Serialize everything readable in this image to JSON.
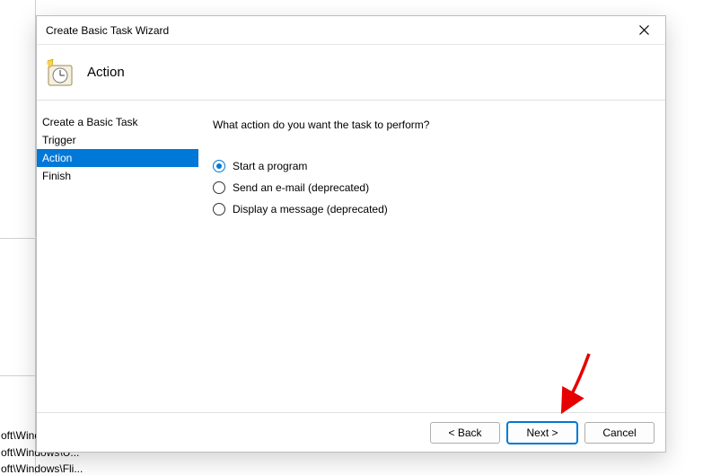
{
  "bg": {
    "path1": "oft\\Windc",
    "path2": "oft\\Windows\\U...",
    "path3": "oft\\Windows\\Fli..."
  },
  "dialog": {
    "title": "Create Basic Task Wizard",
    "header": "Action"
  },
  "nav": {
    "items": [
      {
        "label": "Create a Basic Task"
      },
      {
        "label": "Trigger"
      },
      {
        "label": "Action"
      },
      {
        "label": "Finish"
      }
    ]
  },
  "content": {
    "prompt": "What action do you want the task to perform?",
    "options": [
      {
        "label": "Start a program",
        "checked": true
      },
      {
        "label": "Send an e-mail (deprecated)",
        "checked": false
      },
      {
        "label": "Display a message (deprecated)",
        "checked": false
      }
    ]
  },
  "footer": {
    "back": "< Back",
    "next": "Next >",
    "cancel": "Cancel"
  }
}
